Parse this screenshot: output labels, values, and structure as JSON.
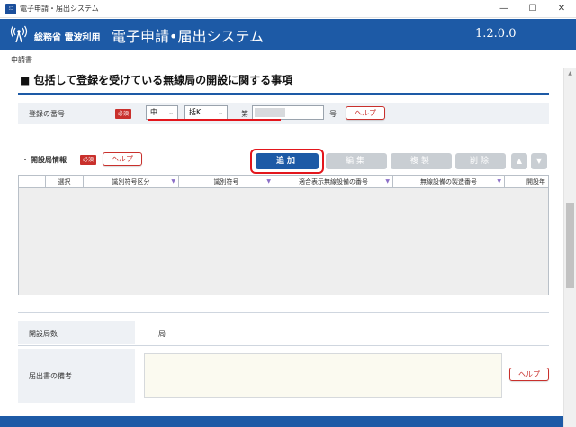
{
  "window": {
    "title": "電子申請・届出システム",
    "app_icon": "ﾐﾆ",
    "controls": {
      "minimize": "—",
      "maximize": "☐",
      "close": "✕"
    }
  },
  "header": {
    "ministry": "総務省 電波利用",
    "system_title": "電子申請•届出システム",
    "version": "1.2.0.0"
  },
  "doc_label": "申請書",
  "section": {
    "heading": "■ 包括して登録を受けている無線局の開設に関する事項",
    "registration": {
      "label": "登録の番号",
      "required": "必須",
      "select1_value": "中",
      "select2_value": "括K",
      "prefix": "第",
      "suffix": "号",
      "help": "ヘルプ"
    },
    "stations": {
      "label": "開設局情報",
      "bullet": "・",
      "required": "必須",
      "help": "ヘルプ",
      "buttons": {
        "add": "追加",
        "edit": "編集",
        "copy": "複製",
        "delete": "削除",
        "up": "▲",
        "down": "▼"
      },
      "columns": [
        "選択",
        "識別符号区分",
        "識別符号",
        "適合表示無線設備の番号",
        "無線設備の製造番号",
        "開設年"
      ]
    },
    "count": {
      "label": "開設局数",
      "unit": "局"
    },
    "remarks": {
      "label": "届出書の備考",
      "help": "ヘルプ"
    }
  },
  "colors": {
    "brand_blue": "#1d5aa6",
    "required_red": "#c9302c",
    "highlight_red": "#e3161c"
  }
}
